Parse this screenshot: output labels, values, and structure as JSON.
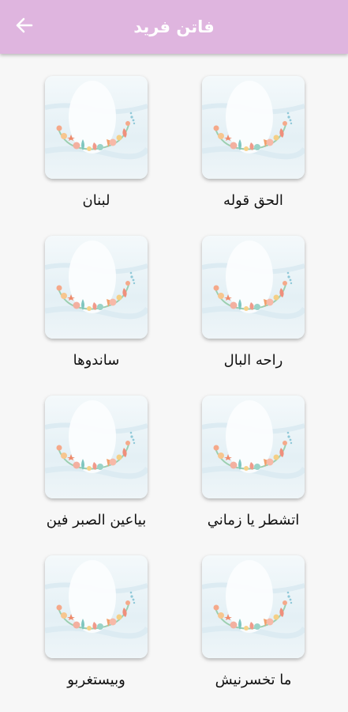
{
  "header": {
    "title": "فاتن فريد",
    "back_icon": "arrow-left-icon",
    "bg_color": "#dfb5df"
  },
  "songs": [
    {
      "label": "الحق قوله"
    },
    {
      "label": "لبنان"
    },
    {
      "label": "راحه البال"
    },
    {
      "label": "ساندوها"
    },
    {
      "label": "اتشطر يا زماني"
    },
    {
      "label": "بياعين الصبر فين"
    },
    {
      "label": "ما تخسرنيش"
    },
    {
      "label": "وبيستغربو"
    }
  ]
}
